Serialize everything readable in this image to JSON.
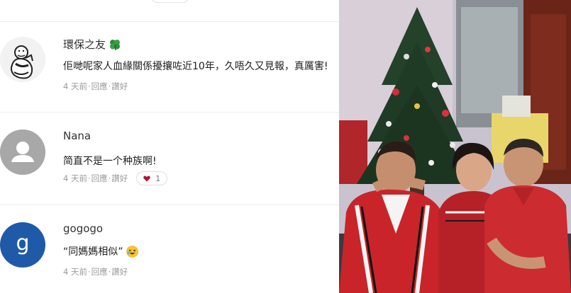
{
  "comments": [
    {
      "name": "環保之友",
      "text": "佢哋呢家人血緣關係擾攘咗近10年，久唔久又見報，真厲害!",
      "time": "4 天前",
      "reply": "回應",
      "like": "讚好"
    },
    {
      "name": "Nana",
      "text": "简直不是一个种族啊!",
      "time": "4 天前",
      "reply": "回應",
      "like": "讚好",
      "like_count": "1"
    },
    {
      "name": "gogogo",
      "avatar_letter": "g",
      "text": "“同媽媽相似”",
      "time": "4 天前",
      "reply": "回應",
      "like": "讚好"
    }
  ],
  "colors": {
    "avatar_blue": "#1e5aa8",
    "avatar_gray": "#a8a8a8",
    "meta_gray": "#9a9a9a",
    "like_heart": "#b3123e"
  },
  "icons": [
    "clover-icon",
    "user-silhouette-icon",
    "laughing-emoji-icon",
    "heart-icon"
  ]
}
